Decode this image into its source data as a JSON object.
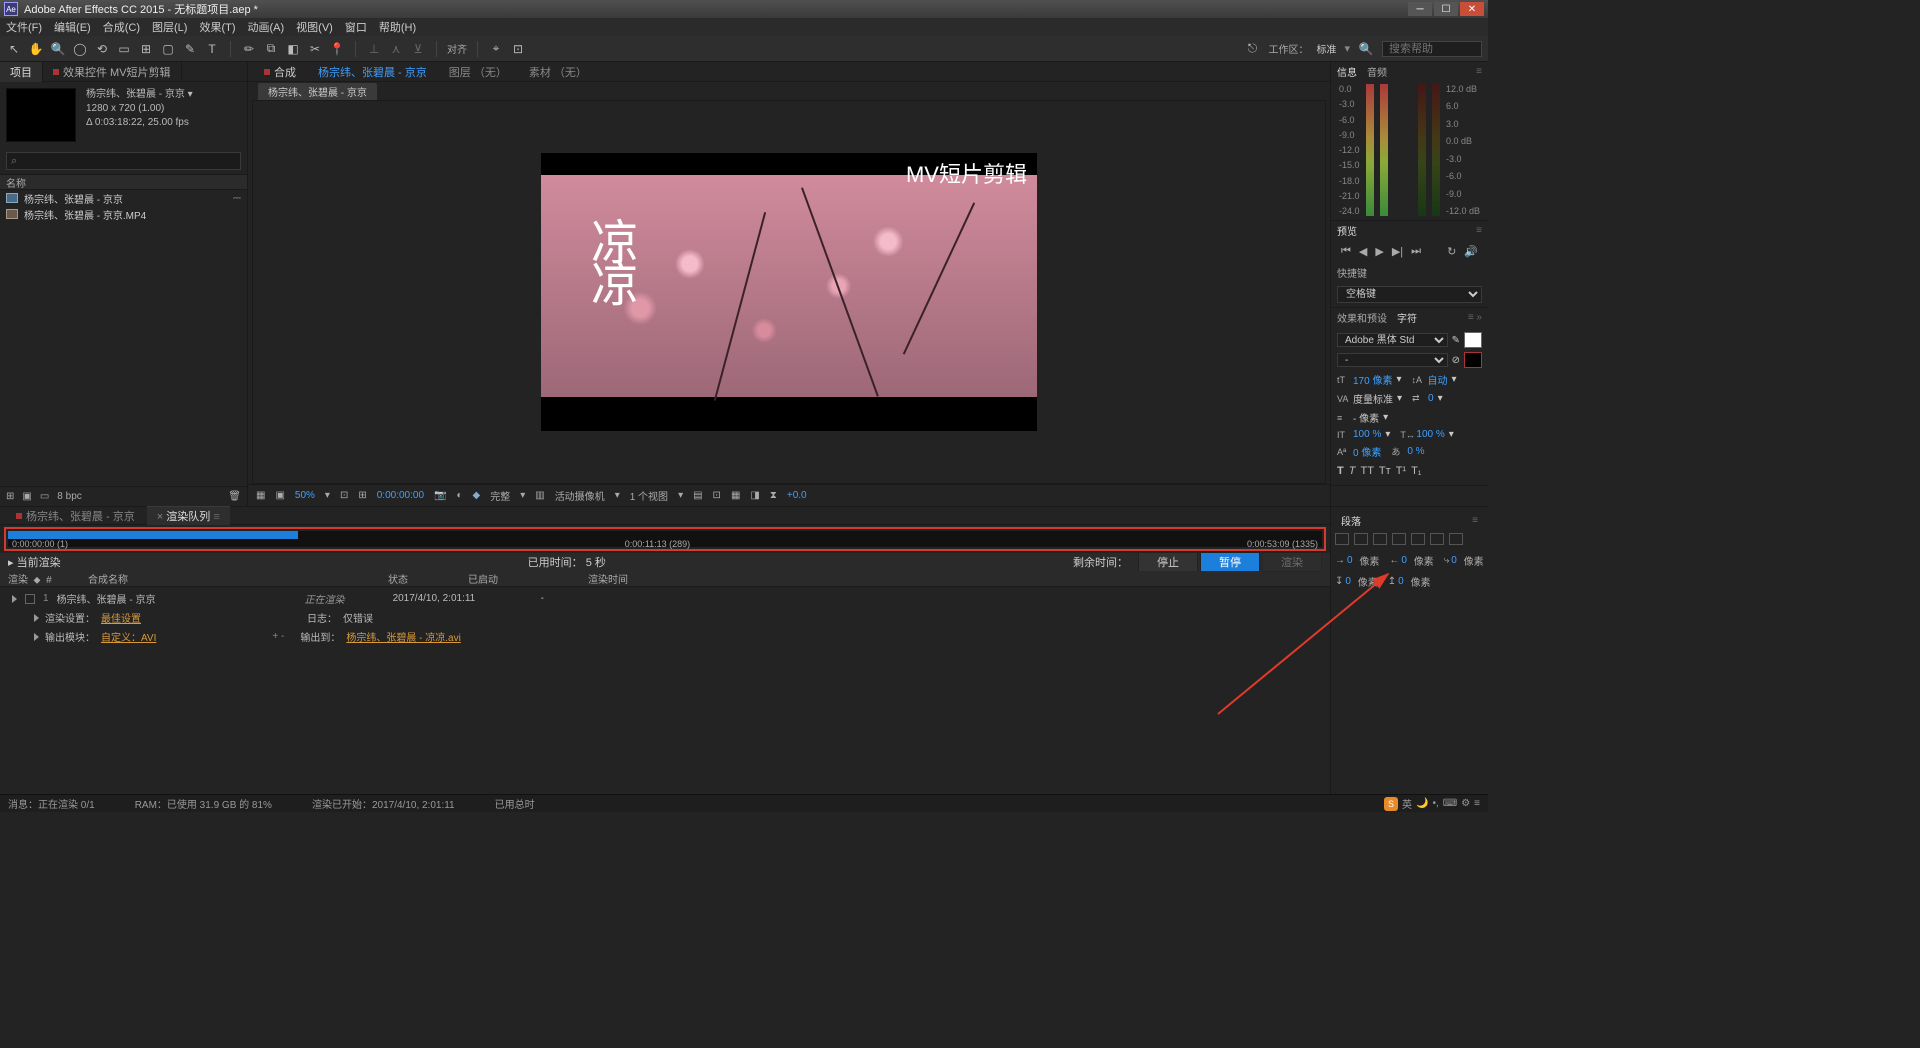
{
  "window": {
    "title": "Adobe After Effects CC 2015 - 无标题项目.aep *"
  },
  "menus": [
    "文件(F)",
    "编辑(E)",
    "合成(C)",
    "图层(L)",
    "效果(T)",
    "动画(A)",
    "视图(V)",
    "窗口",
    "帮助(H)"
  ],
  "toolbar": {
    "align_label": "对齐",
    "workspace_label": "工作区：",
    "workspace_value": "标准",
    "search_placeholder": "搜索帮助"
  },
  "project_panel": {
    "tabs": {
      "project": "项目",
      "effect_controls": "效果控件 MV短片剪辑"
    },
    "comp_name": "杨宗纬、张碧晨 - 京京 ▾",
    "resolution": "1280 x 720 (1.00)",
    "duration": "Δ 0:03:18:22, 25.00 fps",
    "name_header": "名称",
    "items": [
      {
        "type": "comp",
        "name": "杨宗纬、张碧晨 - 京京"
      },
      {
        "type": "file",
        "name": "杨宗纬、张碧晨 - 京京.MP4"
      }
    ],
    "footer_bpc": "8 bpc"
  },
  "comp_tabs": {
    "compose_label": "合成",
    "active_comp": "杨宗纬、张碧晨 - 京京",
    "layout_label": "图层 （无）",
    "footage_label": "素材 （无）",
    "subtab": "杨宗纬、张碧晨 - 京京"
  },
  "canvas": {
    "overlay_title": "MV短片剪辑",
    "song_line1": "凉",
    "song_line2": "凉"
  },
  "viewer_footer": {
    "zoom": "50%",
    "timecode": "0:00:00:00",
    "quality": "完整",
    "camera": "活动摄像机",
    "views": "1 个视图",
    "exposure": "+0.0"
  },
  "right": {
    "info_tab": "信息",
    "audio_tab": "音频",
    "db_left": [
      "0.0",
      "-3.0",
      "-6.0",
      "-9.0",
      "-12.0",
      "-15.0",
      "-18.0",
      "-21.0",
      "-24.0"
    ],
    "db_right": [
      "12.0 dB",
      "6.0",
      "3.0",
      "0.0 dB",
      "-3.0",
      "-6.0",
      "-9.0",
      "-12.0 dB"
    ],
    "preview_tab": "预览",
    "shortcut_label": "快捷键",
    "shortcut_value": "空格键",
    "fx_tab": "效果和预设",
    "char_tab": "字符",
    "font": "Adobe 黑体 Std",
    "font_style": "-",
    "font_size": "170 像素",
    "leading": "自动",
    "kerning": "度量标准",
    "tracking": "0",
    "line_height_unit": "- 像素",
    "scale_v": "100 %",
    "scale_h": "100 %",
    "baseline": "0 像素",
    "baseline2": "0 %",
    "para_tab": "段落"
  },
  "bottom": {
    "timeline_tab": "杨宗纬、张碧晨 - 京京",
    "render_queue_tab": "渲染队列",
    "progress_start": "0:00:00:00 (1)",
    "progress_mid": "0:00:11:13 (289)",
    "progress_end": "0:00:53:09 (1335)",
    "progress_percent": 22,
    "current_render": "当前渲染",
    "elapsed_label": "已用时间：",
    "elapsed_value": "5 秒",
    "remaining_label": "剩余时间：",
    "stop_btn": "停止",
    "pause_btn": "暂停",
    "render_btn": "渲染",
    "headers": {
      "render": "渲染",
      "comp_name": "合成名称",
      "status": "状态",
      "started": "已启动",
      "render_time": "渲染时间"
    },
    "row": {
      "index": "1",
      "comp_name": "杨宗纬、张碧晨 - 京京",
      "status": "正在渲染",
      "started": "2017/4/10, 2:01:11",
      "render_time": "-"
    },
    "subrow1": {
      "label": "渲染设置：",
      "value": "最佳设置",
      "log_label": "日志：",
      "log_value": "仅错误"
    },
    "subrow2": {
      "label": "输出模块：",
      "value": "自定义：AVI",
      "plus": "+  -",
      "out_label": "输出到：",
      "out_file": "杨宗纬、张碧晨 - 凉凉.avi"
    }
  },
  "paragraph": {
    "px_label": "像素",
    "zero": "0"
  },
  "status": {
    "message": "消息：正在渲染 0/1",
    "ram": "RAM：已使用 31.9 GB 的 81%",
    "render_started": "渲染已开始：2017/4/10, 2:01:11",
    "total_elapsed": "已用总时",
    "ime_lang": "英"
  }
}
